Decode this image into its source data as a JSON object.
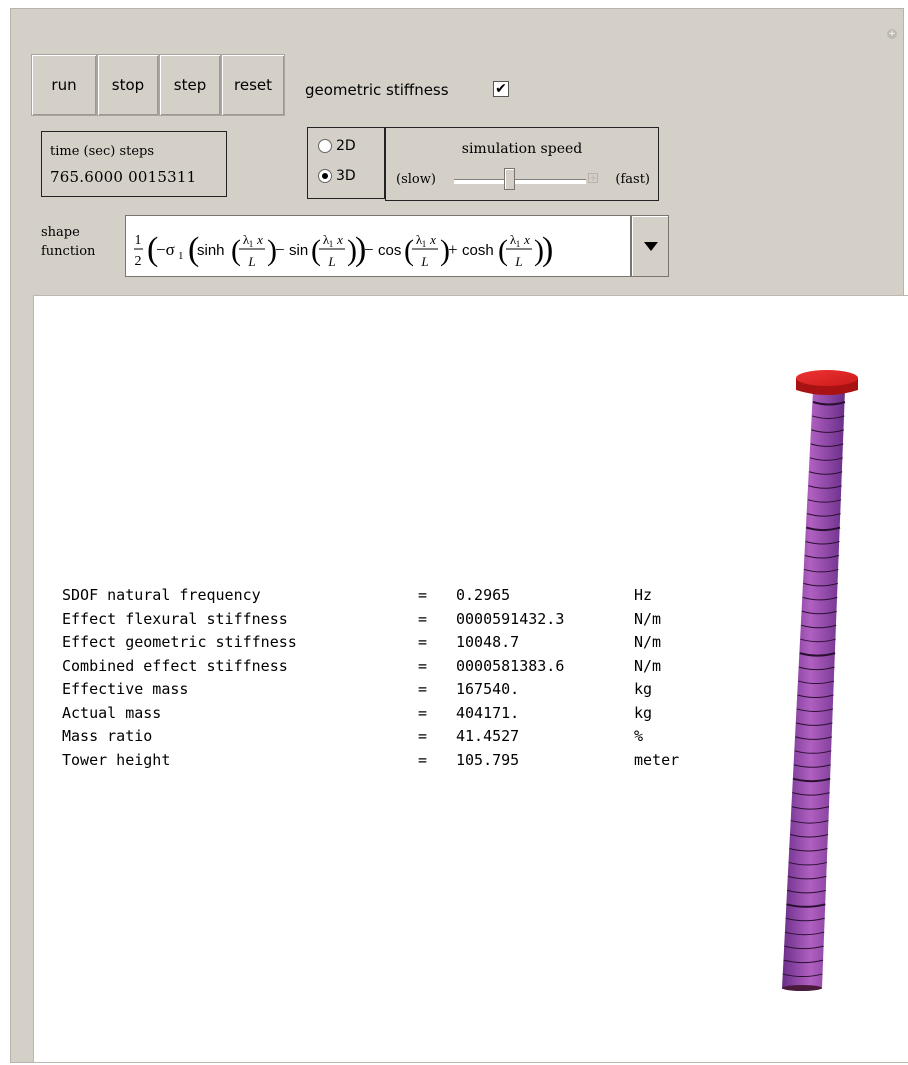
{
  "controls": {
    "run_label": "run",
    "stop_label": "stop",
    "step_label": "step",
    "reset_label": "reset",
    "geometric_stiffness_label": "geometric stiffness",
    "geometric_stiffness_checked": true
  },
  "time": {
    "label": "time (sec) steps",
    "value": "765.6000 0015311"
  },
  "dimension": {
    "options": [
      "2D",
      "3D"
    ],
    "selected": "3D"
  },
  "speed": {
    "title": "simulation speed",
    "slow_label": "(slow)",
    "fast_label": "(fast)",
    "level": 0.42
  },
  "shape_function": {
    "label_line1": "shape",
    "label_line2": "function",
    "expression": {
      "half_num": "1",
      "half_den": "2",
      "sigma": "−σ",
      "sigma_sub": "1",
      "sinh": "sinh",
      "sin": "sin",
      "cos": "cos",
      "cosh": "cosh",
      "frac_num": "λ",
      "frac_num_sub": "1",
      "frac_num_var": "x",
      "frac_den": "L",
      "minus": "−",
      "plus": "+"
    }
  },
  "results": [
    {
      "name": "SDOF natural frequency",
      "eq": "=",
      "value": "0.2965",
      "unit": "Hz"
    },
    {
      "name": "Effect flexural stiffness",
      "eq": "=",
      "value": "0000591432.3",
      "unit": "N/m"
    },
    {
      "name": "Effect geometric stiffness",
      "eq": "=",
      "value": "10048.7",
      "unit": "N/m"
    },
    {
      "name": "Combined effect stiffness",
      "eq": "=",
      "value": "0000581383.6",
      "unit": "N/m"
    },
    {
      "name": "Effective mass",
      "eq": "=",
      "value": "167540.",
      "unit": "kg"
    },
    {
      "name": "Actual mass",
      "eq": "=",
      "value": "404171.",
      "unit": "kg"
    },
    {
      "name": "Mass ratio",
      "eq": "=",
      "value": "41.4527",
      "unit": "%"
    },
    {
      "name": "Tower height",
      "eq": "=",
      "value": "105.795",
      "unit": "meter"
    }
  ],
  "colors": {
    "panel_bg": "#d4d0c8",
    "tower_top": "#cc1a1a",
    "tower_body_light": "#b060c0",
    "tower_body_dark": "#6a2e8a",
    "ring": "#2a1030"
  }
}
